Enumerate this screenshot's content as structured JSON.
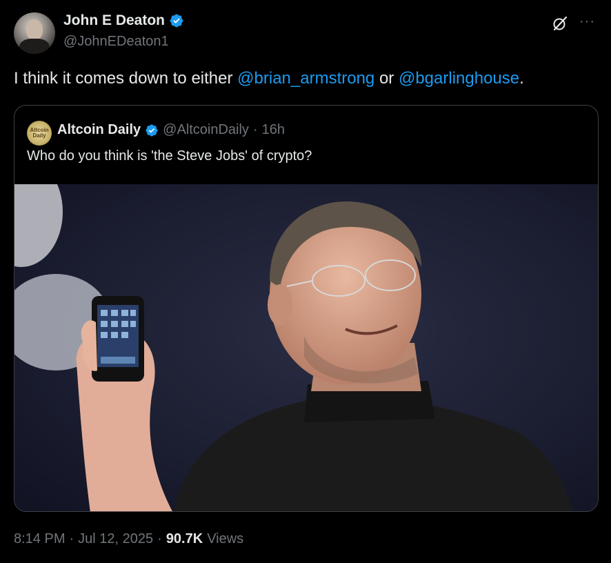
{
  "author": {
    "display_name": "John E Deaton",
    "handle": "@JohnEDeaton1",
    "verified": true
  },
  "tweet": {
    "text_before": "I think it comes down to either ",
    "mention_1": "@brian_armstrong",
    "text_middle": " or ",
    "mention_2": "@bgarlinghouse",
    "text_after": "."
  },
  "quote": {
    "avatar_text": "Altcoin Daily",
    "display_name": "Altcoin Daily",
    "handle": "@AltcoinDaily",
    "separator": "·",
    "time": "16h",
    "text": "Who do you think is 'the Steve Jobs' of crypto?"
  },
  "footer": {
    "time": "8:14 PM",
    "sep1": "·",
    "date": "Jul 12, 2025",
    "sep2": "·",
    "views_count": "90.7K",
    "views_label": "Views"
  },
  "colors": {
    "background": "#000000",
    "accent": "#1d9bf0",
    "muted": "#71767b",
    "text": "#e7e9ea"
  },
  "icons": [
    "verified-badge-icon",
    "grok-icon",
    "more-icon"
  ]
}
